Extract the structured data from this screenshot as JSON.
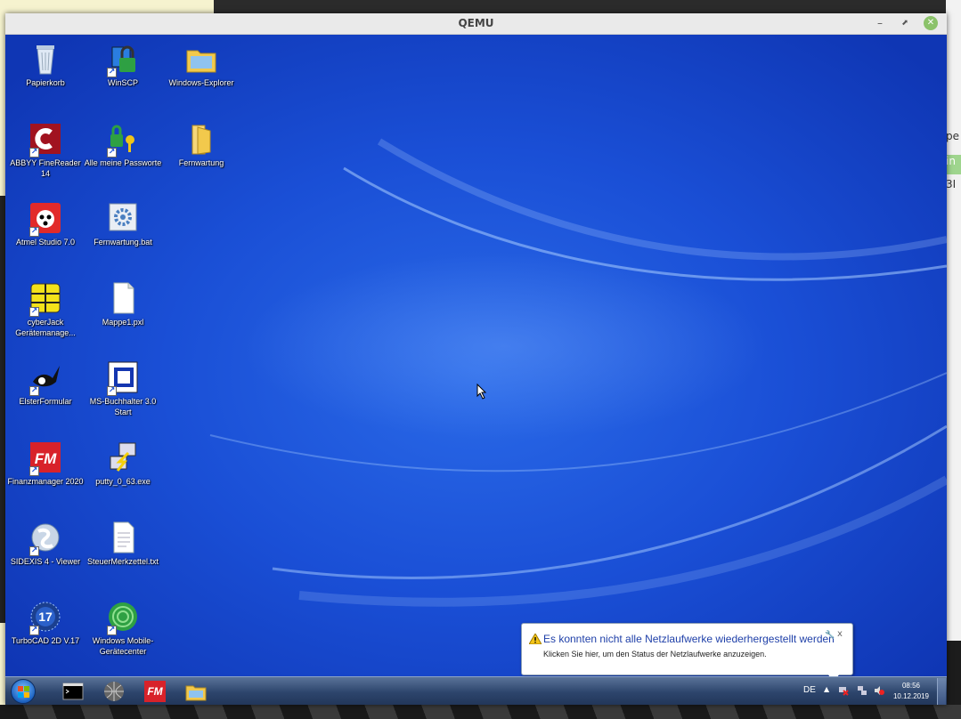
{
  "window": {
    "title": "QEMU",
    "min_label": "–",
    "max_label": "⬈",
    "close_label": "✕"
  },
  "host": {
    "right_frag_1": "pe",
    "right_frag_2": "in",
    "right_frag_3": "3I"
  },
  "desktop_icons": [
    {
      "label": "Papierkorb",
      "icon": "recycle-bin-icon"
    },
    {
      "label": "WinSCP",
      "icon": "winscp-icon"
    },
    {
      "label": "Windows-Explorer",
      "icon": "folder-explorer-icon"
    },
    {
      "label": "ABBYY FineReader 14",
      "icon": "abbyy-icon"
    },
    {
      "label": "Alle meine Passworte",
      "icon": "keys-icon"
    },
    {
      "label": "Fernwartung",
      "icon": "folder-icon"
    },
    {
      "label": "Atmel Studio 7.0",
      "icon": "atmel-ladybug-icon"
    },
    {
      "label": "Fernwartung.bat",
      "icon": "batch-file-icon"
    },
    {
      "label": "cyberJack Gerätemanage...",
      "icon": "chip-card-icon"
    },
    {
      "label": "Mappe1.pxl",
      "icon": "blank-file-icon"
    },
    {
      "label": "ElsterFormular",
      "icon": "magpie-icon"
    },
    {
      "label": "MS-Buchhalter 3.0 Start",
      "icon": "ms-buchhalter-icon"
    },
    {
      "label": "Finanzmanager 2020",
      "icon": "fm-icon"
    },
    {
      "label": "putty_0_63.exe",
      "icon": "putty-icon"
    },
    {
      "label": "SIDEXIS 4 - Viewer",
      "icon": "sidexis-icon"
    },
    {
      "label": "SteuerMerkzettel.txt",
      "icon": "text-file-icon"
    },
    {
      "label": "TurboCAD 2D V.17",
      "icon": "turbocad-icon"
    },
    {
      "label": "Windows Mobile-Gerätecenter",
      "icon": "mobile-center-icon"
    }
  ],
  "balloon": {
    "title": "Es konnten nicht alle Netzlaufwerke wiederhergestellt werden",
    "message": "Klicken Sie hier, um den Status der Netzlaufwerke anzuzeigen.",
    "close": "x"
  },
  "taskbar": {
    "lang": "DE",
    "tray_arrow": "▲",
    "time": "08:56",
    "date": "10.12.2019",
    "pinned": [
      "cmd-icon",
      "globe-icon",
      "fm-icon",
      "explorer-icon"
    ],
    "fm_text": "FM"
  },
  "colors": {
    "desktop": "#1a4fd6",
    "taskbar": "#2d456c",
    "balloon_title": "#1e3fa8"
  }
}
